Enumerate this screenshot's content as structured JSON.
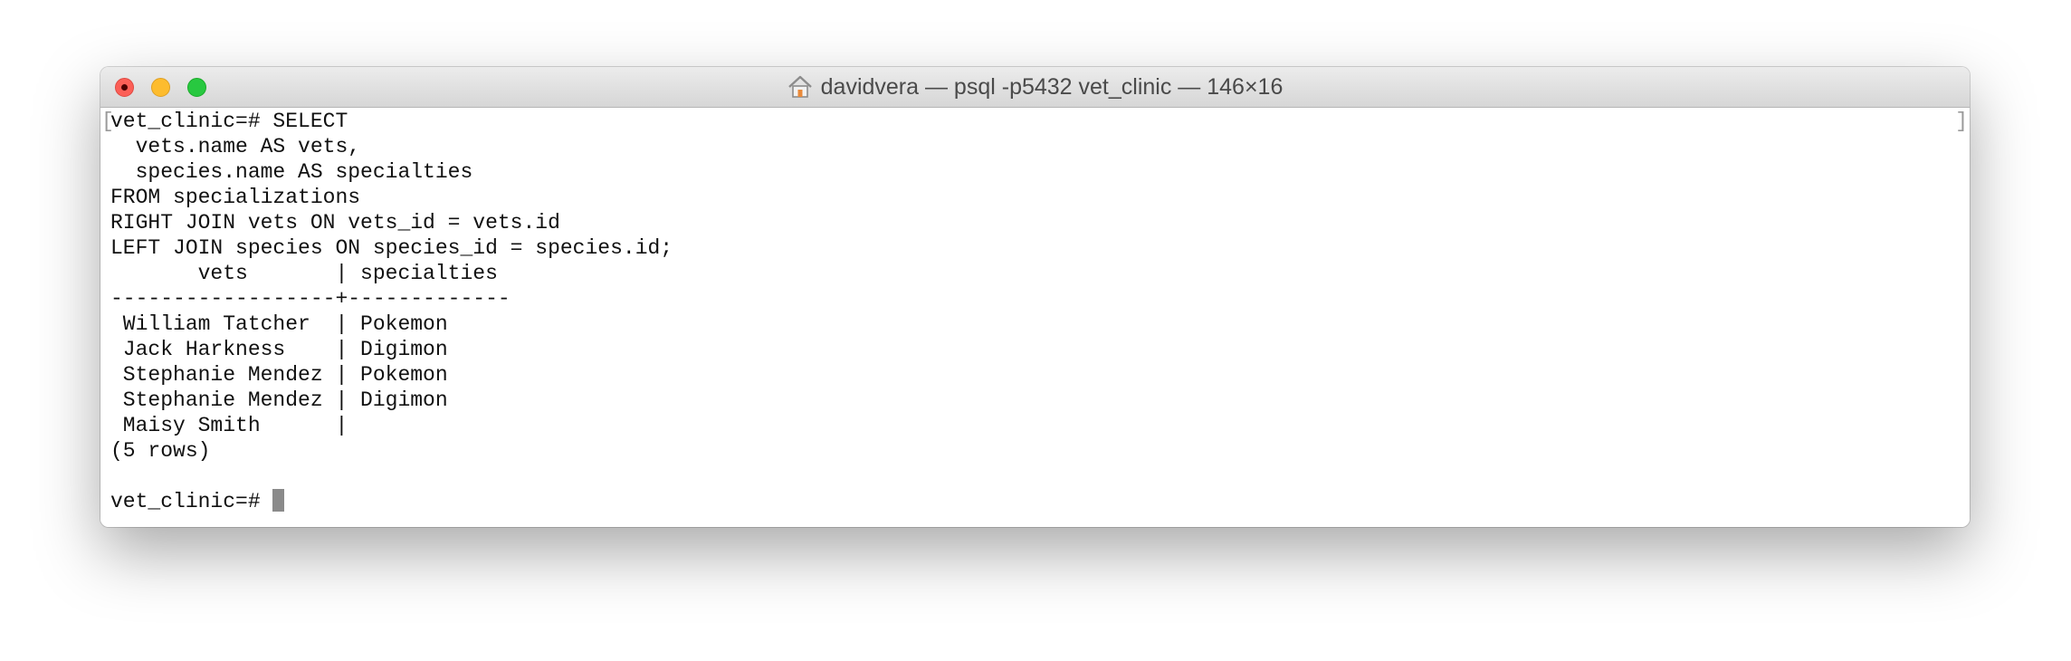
{
  "window": {
    "title": "davidvera — psql -p5432 vet_clinic — 146×16",
    "title_icon": "home-icon",
    "traffic_lights": {
      "close": "#fc5f57",
      "minimize": "#fdbc2e",
      "zoom": "#28c840"
    }
  },
  "terminal": {
    "left_bracket": "[",
    "right_bracket": "]",
    "query_lines": [
      "vet_clinic=# SELECT",
      "  vets.name AS vets,",
      "  species.name AS specialties",
      "FROM specializations",
      "RIGHT JOIN vets ON vets_id = vets.id",
      "LEFT JOIN species ON species_id = species.id;"
    ],
    "result_header": "       vets       | specialties",
    "result_divider": "------------------+-------------",
    "rows": [
      " William Tatcher  | Pokemon",
      " Jack Harkness    | Digimon",
      " Stephanie Mendez | Pokemon",
      " Stephanie Mendez | Digimon",
      " Maisy Smith      |"
    ],
    "row_count": "(5 rows)",
    "prompt": "vet_clinic=# "
  }
}
